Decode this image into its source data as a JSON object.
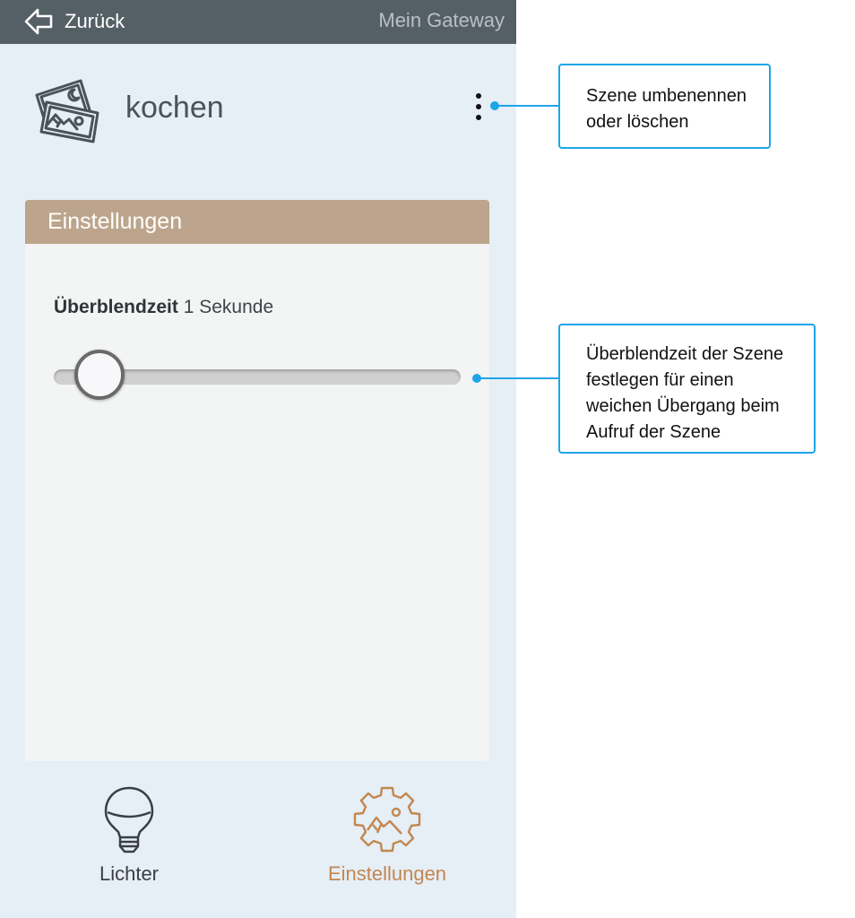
{
  "topbar": {
    "back_label": "Zurück",
    "title": "Mein Gateway"
  },
  "scene": {
    "name": "kochen",
    "icon": "scene-photos-icon"
  },
  "card": {
    "header": "Einstellungen",
    "fade_label": "Überblendzeit",
    "fade_value": "1 Sekunde",
    "slider_value_fraction": 0.0
  },
  "nav": [
    {
      "label": "Lichter",
      "icon": "bulb-icon",
      "active": false
    },
    {
      "label": "Einstellungen",
      "icon": "scene-settings-gear-icon",
      "active": true
    }
  ],
  "callouts": [
    {
      "text": "Szene umbenennen oder löschen"
    },
    {
      "text": "Überblendzeit der Szene festlegen für einen weichen Übergang beim Aufruf der Szene"
    }
  ],
  "colors": {
    "topbar": "#555f66",
    "background": "#e6eef6",
    "card_header": "#bca58c",
    "active_nav": "#c2874f",
    "callout_accent": "#1ea5e8"
  }
}
